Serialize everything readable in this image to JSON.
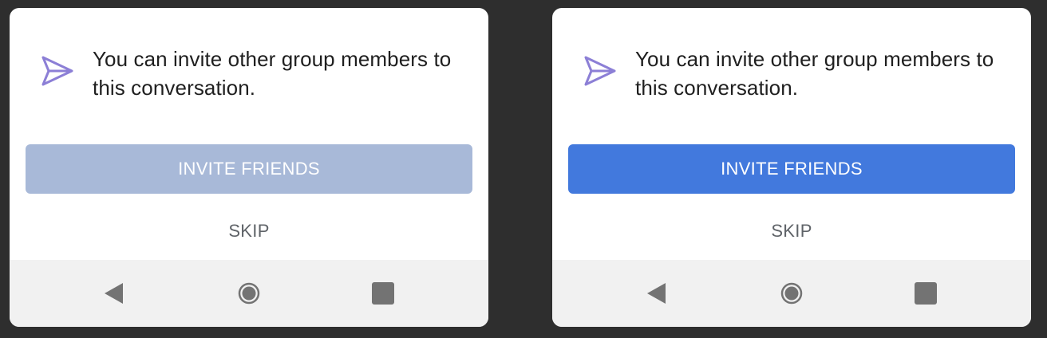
{
  "dialogs": [
    {
      "message": "You can invite other group members to this conversation.",
      "icon": "send-paper-plane-icon",
      "primary_button": {
        "label": "INVITE FRIENDS",
        "state": "disabled",
        "color": "#a8b9d8"
      },
      "secondary_button": {
        "label": "SKIP"
      },
      "nav_bar": {
        "back": "back-triangle-icon",
        "home": "home-circle-icon",
        "recents": "recents-square-icon"
      }
    },
    {
      "message": "You can invite other group members to this conversation.",
      "icon": "send-paper-plane-icon",
      "primary_button": {
        "label": "INVITE FRIENDS",
        "state": "enabled",
        "color": "#4279dd"
      },
      "secondary_button": {
        "label": "SKIP"
      },
      "nav_bar": {
        "back": "back-triangle-icon",
        "home": "home-circle-icon",
        "recents": "recents-square-icon"
      }
    }
  ],
  "colors": {
    "icon_accent": "#8c7fd6",
    "background": "#2e2e2e",
    "nav_bar_bg": "#f1f1f1",
    "nav_icon": "#737373"
  }
}
